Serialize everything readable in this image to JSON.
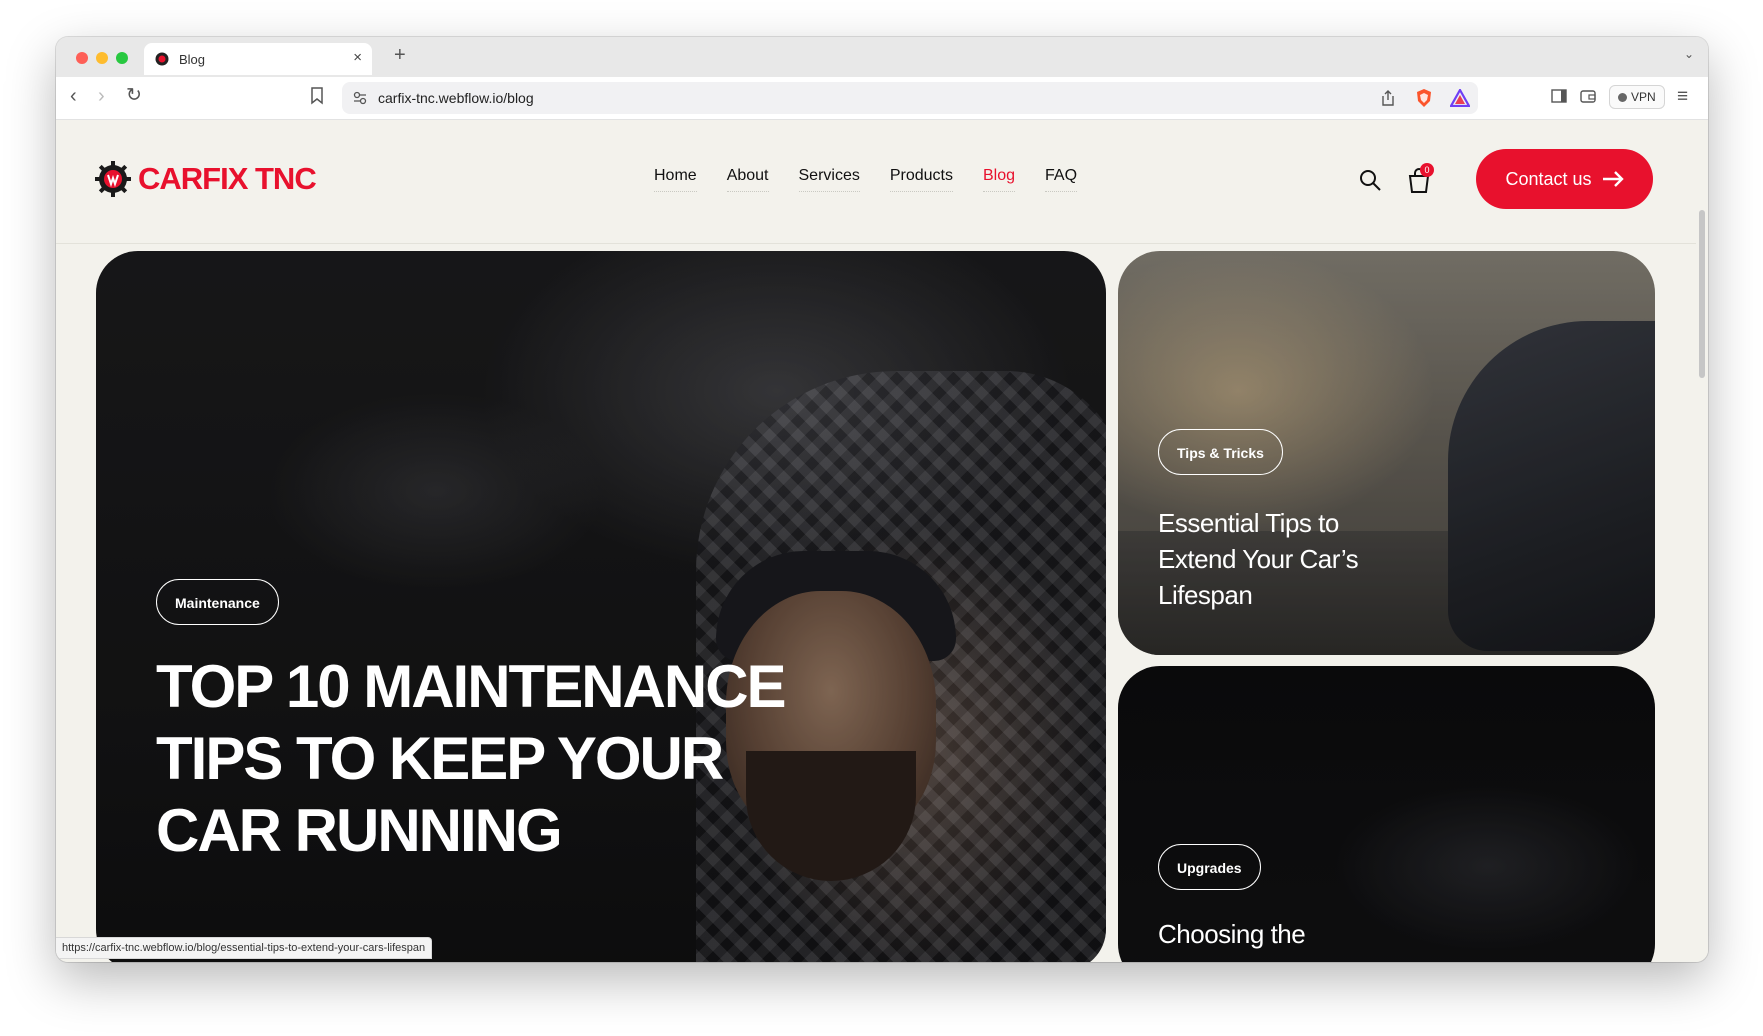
{
  "browser": {
    "tab_title": "Blog",
    "tab_close": "×",
    "new_tab": "+",
    "url": "carfix-tnc.webflow.io/blog",
    "vpn_label": "VPN",
    "status_url": "https://carfix-tnc.webflow.io/blog/essential-tips-to-extend-your-cars-lifespan"
  },
  "header": {
    "logo_text": "CARFIX TNC",
    "nav": [
      "Home",
      "About",
      "Services",
      "Products",
      "Blog",
      "FAQ"
    ],
    "active_nav": "Blog",
    "cart_count": "0",
    "contact_label": "Contact us"
  },
  "posts": {
    "featured": {
      "tag": "Maintenance",
      "title": "TOP 10 MAINTENANCE TIPS TO KEEP YOUR CAR RUNNING"
    },
    "side_top": {
      "tag": "Tips & Tricks",
      "title": "Essential Tips to Extend Your Car’s Lifespan"
    },
    "side_bottom": {
      "tag": "Upgrades",
      "title": "Choosing the"
    }
  },
  "colors": {
    "brand_red": "#e8112d",
    "page_bg": "#f3f2ec"
  },
  "icons": [
    "search-icon",
    "cart-icon",
    "arrow-right-icon",
    "bookmark-icon",
    "share-icon",
    "brave-shield-icon",
    "rewards-icon",
    "hamburger-menu-icon"
  ]
}
